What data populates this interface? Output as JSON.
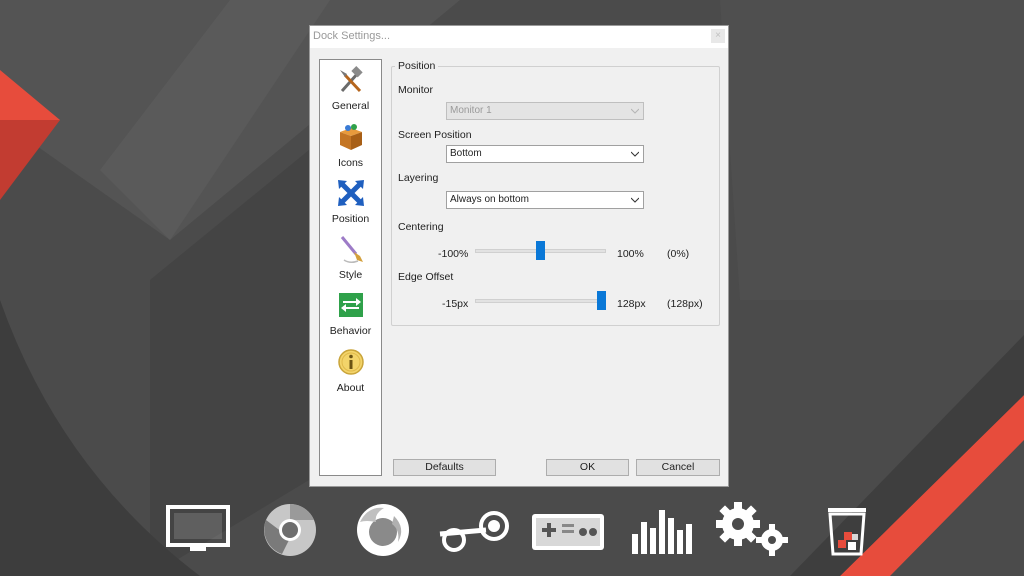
{
  "window": {
    "title": "Dock Settings...",
    "close_glyph": "×"
  },
  "sidebar": {
    "items": [
      {
        "label": "General",
        "icon": "tools-icon"
      },
      {
        "label": "Icons",
        "icon": "box-icon"
      },
      {
        "label": "Position",
        "icon": "arrows-icon"
      },
      {
        "label": "Style",
        "icon": "brush-icon"
      },
      {
        "label": "Behavior",
        "icon": "switch-icon"
      },
      {
        "label": "About",
        "icon": "info-icon"
      }
    ],
    "selected": "Position"
  },
  "position": {
    "group_title": "Position",
    "monitor": {
      "label": "Monitor",
      "value": "Monitor 1",
      "disabled": true
    },
    "screen_position": {
      "label": "Screen Position",
      "value": "Bottom"
    },
    "layering": {
      "label": "Layering",
      "value": "Always on bottom"
    },
    "centering": {
      "label": "Centering",
      "min": "-100%",
      "max": "100%",
      "value": "(0%)",
      "fraction": 0.5
    },
    "edge_offset": {
      "label": "Edge Offset",
      "min": "-15px",
      "max": "128px",
      "value": "(128px)",
      "fraction": 1.0
    }
  },
  "buttons": {
    "defaults": "Defaults",
    "ok": "OK",
    "cancel": "Cancel"
  },
  "dock": {
    "icons": [
      "monitor-icon",
      "chrome-icon",
      "firefox-icon",
      "steam-icon",
      "gamepad-icon",
      "equalizer-icon",
      "gears-icon",
      "trash-icon"
    ]
  },
  "colors": {
    "accent": "#0a78d7",
    "background": "#4a4a4a",
    "stripe": "#e74c3c"
  }
}
